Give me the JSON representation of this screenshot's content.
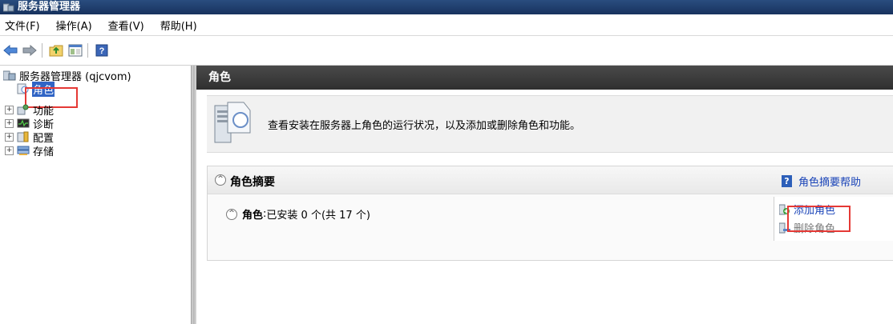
{
  "window": {
    "title": "服务器管理器",
    "icon": "server-manager-icon"
  },
  "menubar": {
    "items": [
      "文件(F)",
      "操作(A)",
      "查看(V)",
      "帮助(H)"
    ]
  },
  "toolbar": {
    "buttons": [
      "back-arrow-icon",
      "forward-arrow-icon",
      "up-folder-icon",
      "show-hide-tree-icon",
      "help-icon"
    ]
  },
  "tree": {
    "root": {
      "label": "服务器管理器 (qjcvom)",
      "icon": "server-manager-icon"
    },
    "items": [
      {
        "label": "角色",
        "icon": "roles-icon",
        "selected": true,
        "expander": ""
      },
      {
        "label": "功能",
        "icon": "features-icon",
        "expander": "+"
      },
      {
        "label": "诊断",
        "icon": "diagnostics-icon",
        "expander": "+"
      },
      {
        "label": "配置",
        "icon": "configuration-icon",
        "expander": "+"
      },
      {
        "label": "存储",
        "icon": "storage-icon",
        "expander": "+"
      }
    ]
  },
  "main": {
    "header": "角色",
    "description": "查看安装在服务器上角色的运行状况，以及添加或删除角色和功能。",
    "summary": {
      "title": "角色摘要",
      "help_link": "角色摘要帮助",
      "roles_label": "角色",
      "roles_status": "已安装 0 个(共 17 个)",
      "actions": {
        "add": "添加角色",
        "remove": "删除角色"
      }
    }
  },
  "colors": {
    "title_bar": "#1f3f70",
    "selection": "#3165c5",
    "link": "#1a44b8",
    "highlight_box": "#e53935",
    "header_dark": "#3a3a3a"
  }
}
